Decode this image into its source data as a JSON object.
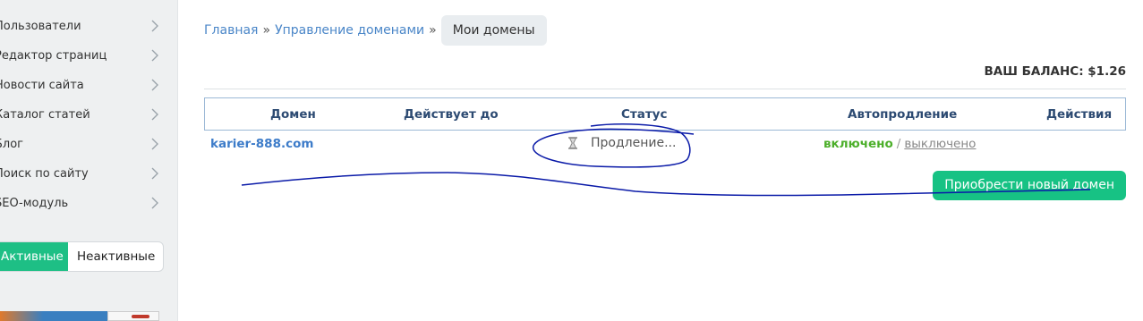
{
  "sidebar": {
    "items": [
      {
        "label": "Пользователи"
      },
      {
        "label": "Редактор страниц"
      },
      {
        "label": "Новости сайта"
      },
      {
        "label": "Каталог статей"
      },
      {
        "label": "Блог"
      },
      {
        "label": "Поиск по сайту"
      },
      {
        "label": "SEO-модуль"
      }
    ],
    "toggle": {
      "active_label": "Активные",
      "inactive_label": "Неактивные"
    }
  },
  "breadcrumb": {
    "home": "Главная",
    "separator": "»",
    "domains": "Управление доменами",
    "current": "Мои домены"
  },
  "balance": "ВАШ БАЛАНС: $1.26",
  "table": {
    "headers": [
      "Домен",
      "Действует до",
      "Статус",
      "Автопродление",
      "Действия"
    ],
    "rows": [
      {
        "domain": "karier-888.com",
        "valid_until": "",
        "status": "Продление...",
        "status_icon": "hourglass-icon",
        "auto_on": "включено",
        "auto_sep": "/",
        "auto_off": "выключено"
      }
    ]
  },
  "buy_button": "Приобрести новый домен",
  "colors": {
    "accent_green": "#17c284",
    "link_blue": "#3d7cc9",
    "header_text": "#2c4a72",
    "enabled_green": "#4caf2a",
    "annotation_ink": "#0a1aa8"
  }
}
